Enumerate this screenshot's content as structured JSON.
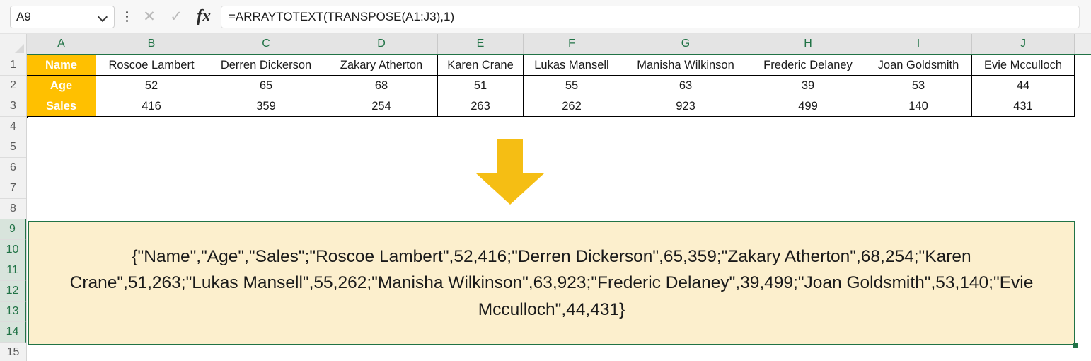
{
  "formula_bar": {
    "name_box_value": "A9",
    "cancel_icon": "close-icon",
    "confirm_icon": "check-icon",
    "fx_label": "fx",
    "formula_value": "=ARRAYTOTEXT(TRANSPOSE(A1:J3),1)",
    "formula_placeholder": ""
  },
  "grid": {
    "column_headers": [
      "A",
      "B",
      "C",
      "D",
      "E",
      "F",
      "G",
      "H",
      "I",
      "J"
    ],
    "row_headers": [
      "1",
      "2",
      "3",
      "4",
      "5",
      "6",
      "7",
      "8",
      "9",
      "10",
      "11",
      "12",
      "13",
      "14",
      "15"
    ],
    "selected_rows": [
      "9",
      "10",
      "11",
      "12",
      "13",
      "14"
    ],
    "row_labels": [
      "Name",
      "Age",
      "Sales"
    ],
    "table": {
      "headers": [
        "Name",
        "Age",
        "Sales"
      ],
      "columns": [
        {
          "col": "B",
          "name": "Roscoe Lambert",
          "age": "52",
          "sales": "416"
        },
        {
          "col": "C",
          "name": "Derren Dickerson",
          "age": "65",
          "sales": "359"
        },
        {
          "col": "D",
          "name": "Zakary Atherton",
          "age": "68",
          "sales": "254"
        },
        {
          "col": "E",
          "name": "Karen Crane",
          "age": "51",
          "sales": "263"
        },
        {
          "col": "F",
          "name": "Lukas Mansell",
          "age": "55",
          "sales": "262"
        },
        {
          "col": "G",
          "name": "Manisha Wilkinson",
          "age": "63",
          "sales": "923"
        },
        {
          "col": "H",
          "name": "Frederic Delaney",
          "age": "39",
          "sales": "499"
        },
        {
          "col": "I",
          "name": "Joan Goldsmith",
          "age": "53",
          "sales": "140"
        },
        {
          "col": "J",
          "name": "Evie Mcculloch",
          "age": "44",
          "sales": "431"
        }
      ]
    },
    "arrow_icon": "down-arrow-icon",
    "result_cell": {
      "address": "A9",
      "value": "{\"Name\",\"Age\",\"Sales\";\"Roscoe Lambert\",52,416;\"Derren Dickerson\",65,359;\"Zakary Atherton\",68,254;\"Karen Crane\",51,263;\"Lukas Mansell\",55,262;\"Manisha Wilkinson\",63,923;\"Frederic Delaney\",39,499;\"Joan Goldsmith\",53,140;\"Evie Mcculloch\",44,431}"
    }
  },
  "colors": {
    "accent_green": "#217346",
    "label_amber": "#FFC000",
    "arrow_amber": "#F5BE14",
    "result_fill": "#FCEFCD"
  }
}
